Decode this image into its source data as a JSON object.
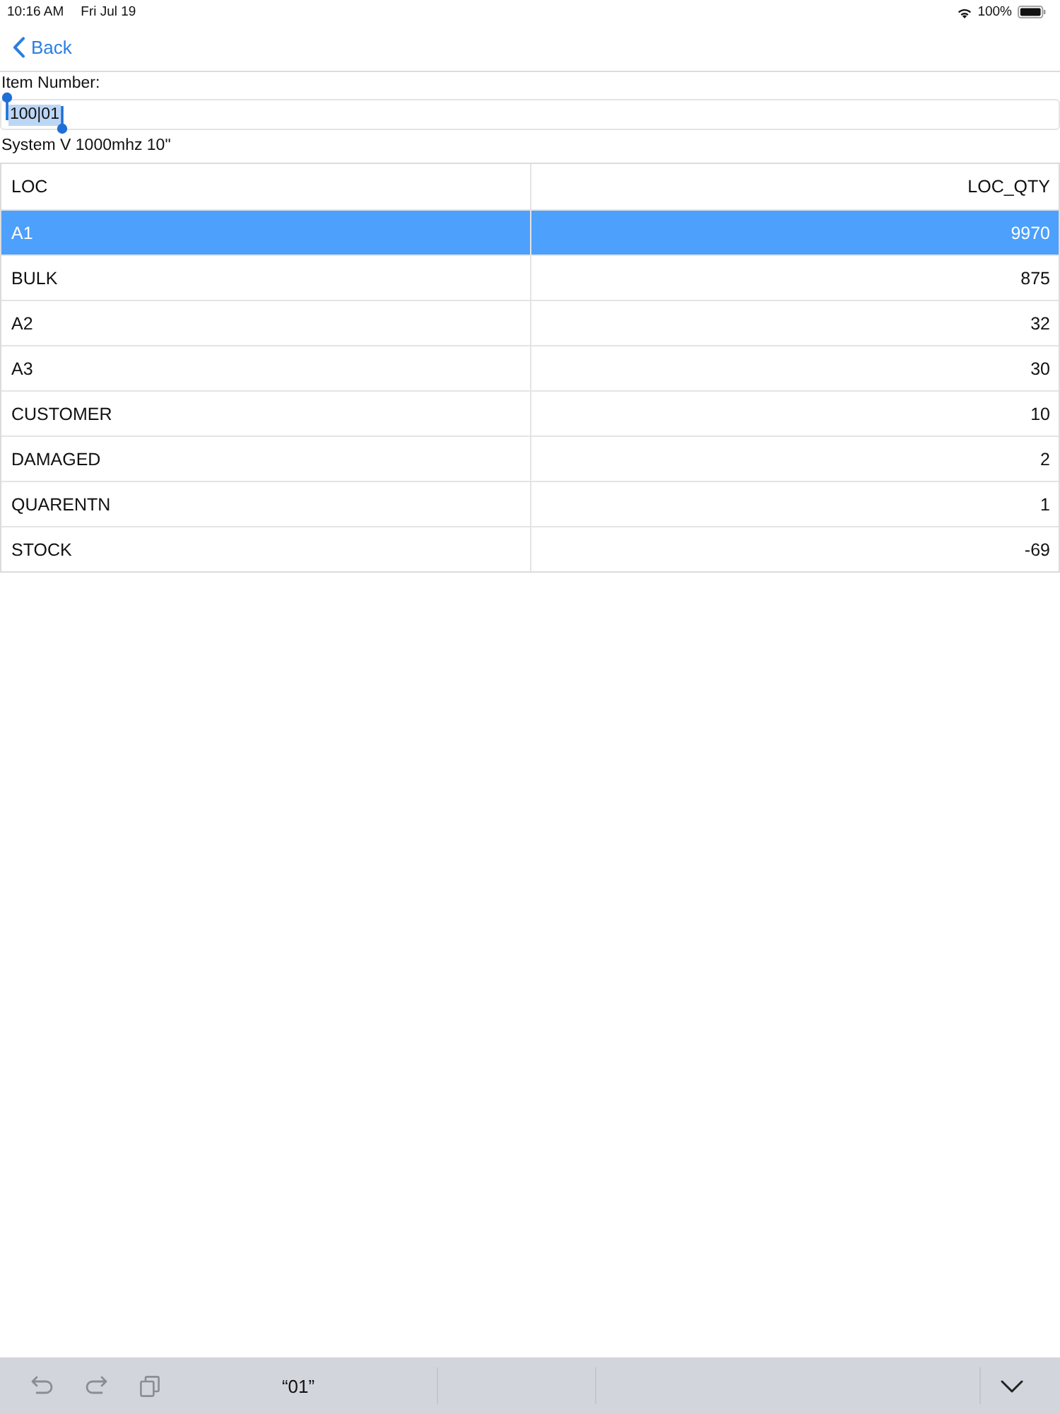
{
  "status_bar": {
    "time": "10:16 AM",
    "date": "Fri Jul 19",
    "battery": "100%"
  },
  "nav": {
    "back": "Back"
  },
  "form": {
    "label": "Item Number:",
    "value": "100|01",
    "text_selected": true,
    "description": "System V 1000mhz 10\""
  },
  "table": {
    "columns": [
      "LOC",
      "LOC_QTY"
    ],
    "rows": [
      {
        "cells": [
          "A1",
          "9970"
        ],
        "selected": true
      },
      {
        "cells": [
          "BULK",
          "875"
        ],
        "selected": false
      },
      {
        "cells": [
          "A2",
          "32"
        ],
        "selected": false
      },
      {
        "cells": [
          "A3",
          "30"
        ],
        "selected": false
      },
      {
        "cells": [
          "CUSTOMER",
          "10"
        ],
        "selected": false
      },
      {
        "cells": [
          "DAMAGED",
          "2"
        ],
        "selected": false
      },
      {
        "cells": [
          "QUARENTN",
          "1"
        ],
        "selected": false
      },
      {
        "cells": [
          "STOCK",
          "-69"
        ],
        "selected": false
      }
    ]
  },
  "keyboard_bar": {
    "suggestion": "“01”"
  }
}
